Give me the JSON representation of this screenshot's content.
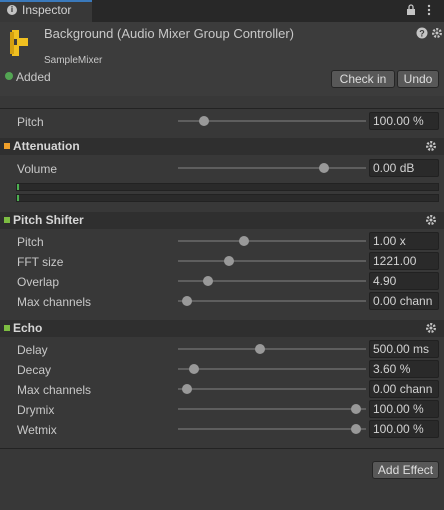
{
  "tab": {
    "label": "Inspector"
  },
  "header": {
    "title": "Background (Audio Mixer Group Controller)",
    "subtitle": "SampleMixer",
    "added_label": "Added",
    "checkin_label": "Check in",
    "undo_label": "Undo"
  },
  "pitch": {
    "label": "Pitch",
    "value": "100.00 %",
    "level": 0.12
  },
  "attenuation": {
    "title": "Attenuation",
    "volume": {
      "label": "Volume",
      "value": "0.00 dB",
      "level": 0.79
    },
    "color": "#f0a02a"
  },
  "pitch_shifter": {
    "title": "Pitch Shifter",
    "color": "#7dbd42",
    "rows": [
      {
        "label": "Pitch",
        "value": "1.00 x",
        "level": 0.34
      },
      {
        "label": "FFT size",
        "value": "1221.00",
        "level": 0.26
      },
      {
        "label": "Overlap",
        "value": "4.90",
        "level": 0.14
      },
      {
        "label": "Max channels",
        "value": "0.00 chann",
        "level": 0.02
      }
    ]
  },
  "echo": {
    "title": "Echo",
    "color": "#7dbd42",
    "rows": [
      {
        "label": "Delay",
        "value": "500.00 ms",
        "level": 0.43
      },
      {
        "label": "Decay",
        "value": "3.60 %",
        "level": 0.06
      },
      {
        "label": "Max channels",
        "value": "0.00 chann",
        "level": 0.02
      },
      {
        "label": "Drymix",
        "value": "100.00 %",
        "level": 0.97
      },
      {
        "label": "Wetmix",
        "value": "100.00 %",
        "level": 0.97
      }
    ]
  },
  "add_effect_label": "Add Effect",
  "icons": [
    "info-icon",
    "lock-icon",
    "menu-icon",
    "audio-mixer-icon",
    "help-icon",
    "settings-icon"
  ]
}
